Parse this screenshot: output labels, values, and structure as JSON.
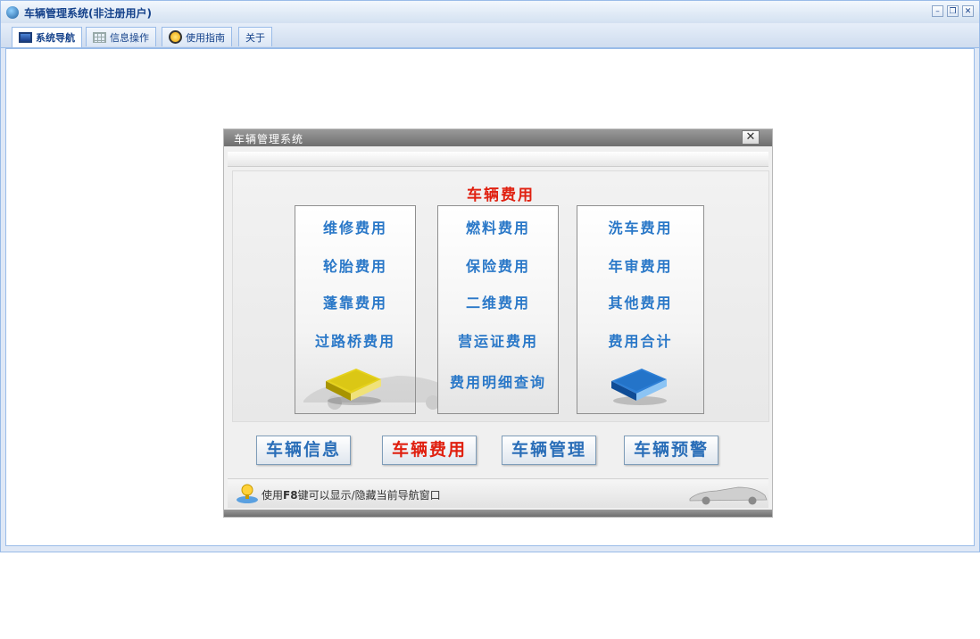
{
  "window": {
    "title": "车辆管理系统(非注册用户)",
    "controls": [
      "minimize",
      "restore",
      "close"
    ]
  },
  "tabs": [
    {
      "label": "系统导航",
      "icon": "monitor-icon",
      "active": true
    },
    {
      "label": "信息操作",
      "icon": "grid-icon",
      "active": false
    },
    {
      "label": "使用指南",
      "icon": "help-circle-icon",
      "active": false
    },
    {
      "label": "关于",
      "icon": "",
      "active": false
    }
  ],
  "dialog": {
    "title": "车辆管理系统",
    "close_glyph": "✕",
    "section_title": "车辆费用",
    "columns": [
      {
        "items": [
          "维修费用",
          "轮胎费用",
          "蓬靠费用",
          "过路桥费用"
        ],
        "icon": "yellow-binder-icon"
      },
      {
        "items": [
          "燃料费用",
          "保险费用",
          "二维费用",
          "营运证费用",
          "费用明细查询"
        ],
        "icon": ""
      },
      {
        "items": [
          "洗车费用",
          "年审费用",
          "其他费用",
          "费用合计"
        ],
        "icon": "blue-binder-icon"
      }
    ],
    "nav_buttons": [
      {
        "label": "车辆信息",
        "active": false
      },
      {
        "label": "车辆费用",
        "active": true
      },
      {
        "label": "车辆管理",
        "active": false
      },
      {
        "label": "车辆预警",
        "active": false
      }
    ],
    "hint": {
      "prefix": "使用",
      "key": "F8",
      "suffix": "键可以显示/隐藏当前导航窗口"
    }
  },
  "colors": {
    "accent_red": "#e02010",
    "item_blue": "#2a78c8",
    "frame_blue": "#99bbe8",
    "title_text": "#15428b"
  }
}
